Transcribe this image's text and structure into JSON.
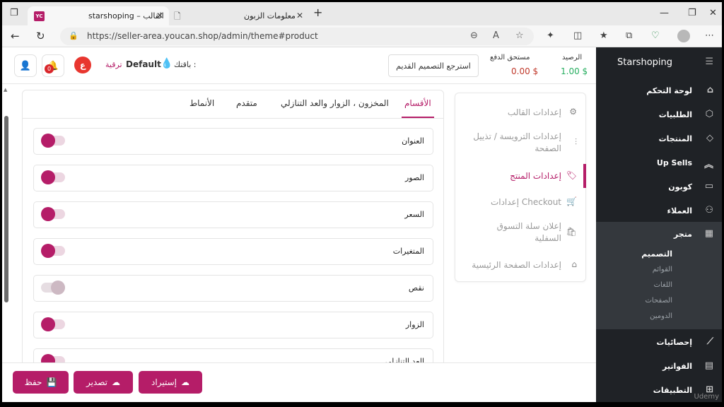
{
  "browser": {
    "tabs": [
      {
        "title": "starshoping – القالب",
        "badge": "YC",
        "active": true
      },
      {
        "title": "معلومات الزبون",
        "active": false
      }
    ],
    "url": "https://seller-area.youcan.shop/admin/theme#product"
  },
  "header": {
    "balance_label": "الرصيد",
    "balance_value": "1.00 $",
    "due_label": "مستحق الدفع",
    "due_value": "0.00 $",
    "restore_button": "استرجع التصميم القديم",
    "plan_label": "باقتك :",
    "plan_value": "Default",
    "upgrade_link": "ترقية",
    "lang_badge": "ع",
    "notif_count": "0"
  },
  "sidebar": {
    "brand": "Starshoping",
    "items": [
      {
        "label": "لوحة التحكم",
        "icon": "home-icon"
      },
      {
        "label": "الطلبيات",
        "icon": "box-icon"
      },
      {
        "label": "المنتجات",
        "icon": "tag-icon"
      },
      {
        "label": "Up Sells",
        "icon": "chevrons-up-icon"
      },
      {
        "label": "كوبون",
        "icon": "ticket-icon"
      },
      {
        "label": "العملاء",
        "icon": "users-icon"
      },
      {
        "label": "متجر",
        "icon": "store-icon"
      },
      {
        "label": "إحصائيات",
        "icon": "chart-icon"
      },
      {
        "label": "الفواتير",
        "icon": "invoice-icon"
      },
      {
        "label": "التطبيقات",
        "icon": "apps-icon"
      }
    ],
    "store_sub": [
      "التصميم",
      "القوائم",
      "اللغات",
      "الصفحات",
      "الدومين"
    ]
  },
  "settings_menu": [
    {
      "label": "إعدادات القالب",
      "icon": "gear-icon"
    },
    {
      "label": "إعدادات الترويسة / تذييل الصفحة",
      "icon": "sliders-icon"
    },
    {
      "label": "إعدادات المنتج",
      "icon": "tag-icon",
      "active": true
    },
    {
      "label": "إعدادات Checkout",
      "icon": "cart-icon"
    },
    {
      "label": "إعلان سلة التسوق السفلية",
      "icon": "basket-icon"
    },
    {
      "label": "إعدادات الصفحة الرئيسية",
      "icon": "home-icon"
    }
  ],
  "content_tabs": [
    "الأقسام",
    "المخزون ، الزوار والعد التنازلي",
    "متقدم",
    "الأنماط"
  ],
  "sections": [
    {
      "label": "العنوان",
      "on": true
    },
    {
      "label": "الصور",
      "on": true
    },
    {
      "label": "السعر",
      "on": true
    },
    {
      "label": "المتغيرات",
      "on": true
    },
    {
      "label": "نقص",
      "on": false
    },
    {
      "label": "الزوار",
      "on": true
    },
    {
      "label": "العد التنازلي",
      "on": true
    }
  ],
  "footer": {
    "save": "حفظ",
    "export": "تصدير",
    "import": "إستيراد"
  },
  "watermark": "Udemy",
  "colors": {
    "accent": "#b51d68",
    "sidebar_bg": "#1f2226",
    "balance": "#27ae60",
    "due": "#c0392b"
  }
}
